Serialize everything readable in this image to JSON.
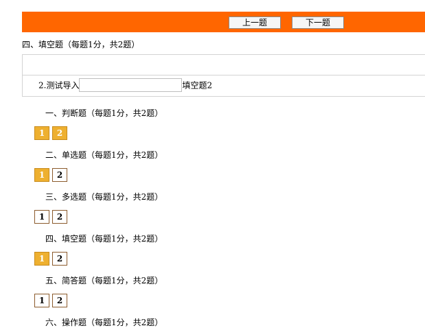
{
  "toolbar": {
    "prev_label": "上一题",
    "next_label": "下一题"
  },
  "section_title": "四、填空题（每题1分，共2题）",
  "question": {
    "text_before": "2.测试导入",
    "input_value": "",
    "text_after": "填空题2"
  },
  "groups": [
    {
      "title": "一、判断题（每题1分，共2题）",
      "items": [
        {
          "label": "1",
          "answered": true
        },
        {
          "label": "2",
          "answered": true
        }
      ]
    },
    {
      "title": "二、单选题（每题1分，共2题）",
      "items": [
        {
          "label": "1",
          "answered": true
        },
        {
          "label": "2",
          "answered": false
        }
      ]
    },
    {
      "title": "三、多选题（每题1分，共2题）",
      "items": [
        {
          "label": "1",
          "answered": false
        },
        {
          "label": "2",
          "answered": false
        }
      ]
    },
    {
      "title": "四、填空题（每题1分，共2题）",
      "items": [
        {
          "label": "1",
          "answered": true
        },
        {
          "label": "2",
          "answered": false
        }
      ]
    },
    {
      "title": "五、简答题（每题1分，共2题）",
      "items": [
        {
          "label": "1",
          "answered": false
        },
        {
          "label": "2",
          "answered": false
        }
      ]
    },
    {
      "title": "六、操作题（每题1分，共2题）"
    }
  ],
  "colors": {
    "topbar": "#ff6600",
    "answered": "#eeb030"
  }
}
